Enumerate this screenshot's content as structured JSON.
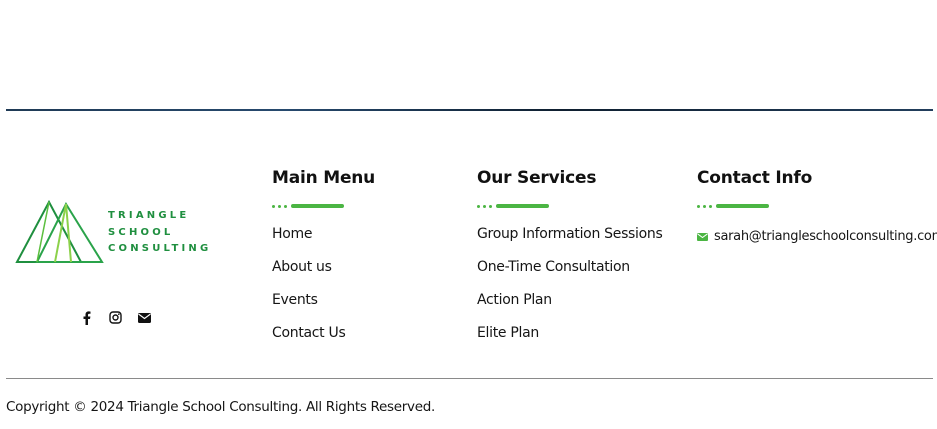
{
  "logo": {
    "lines": [
      "TRIANGLE",
      "SCHOOL",
      "CONSULTING"
    ],
    "icon": "triangle-logo-icon",
    "color": "#1f8f3f",
    "accent": "#8cd14a"
  },
  "social": {
    "icons": [
      "facebook-icon",
      "instagram-icon",
      "envelope-icon"
    ]
  },
  "main_menu": {
    "title": "Main Menu",
    "items": [
      "Home",
      "About us",
      "Events",
      "Contact Us"
    ]
  },
  "services": {
    "title": "Our Services",
    "items": [
      "Group Information Sessions",
      "One-Time Consultation",
      "Action Plan",
      "Elite Plan"
    ]
  },
  "contact": {
    "title": "Contact Info",
    "email": "sarah@triangleschoolconsulting.com",
    "icon": "envelope-icon"
  },
  "footer": {
    "copyright": "Copyright © 2024 Triangle School Consulting. All Rights Reserved."
  },
  "colors": {
    "accent_green": "#4bb543",
    "brand_green": "#1f8f3f",
    "rule_navy": "#1f3a55"
  }
}
